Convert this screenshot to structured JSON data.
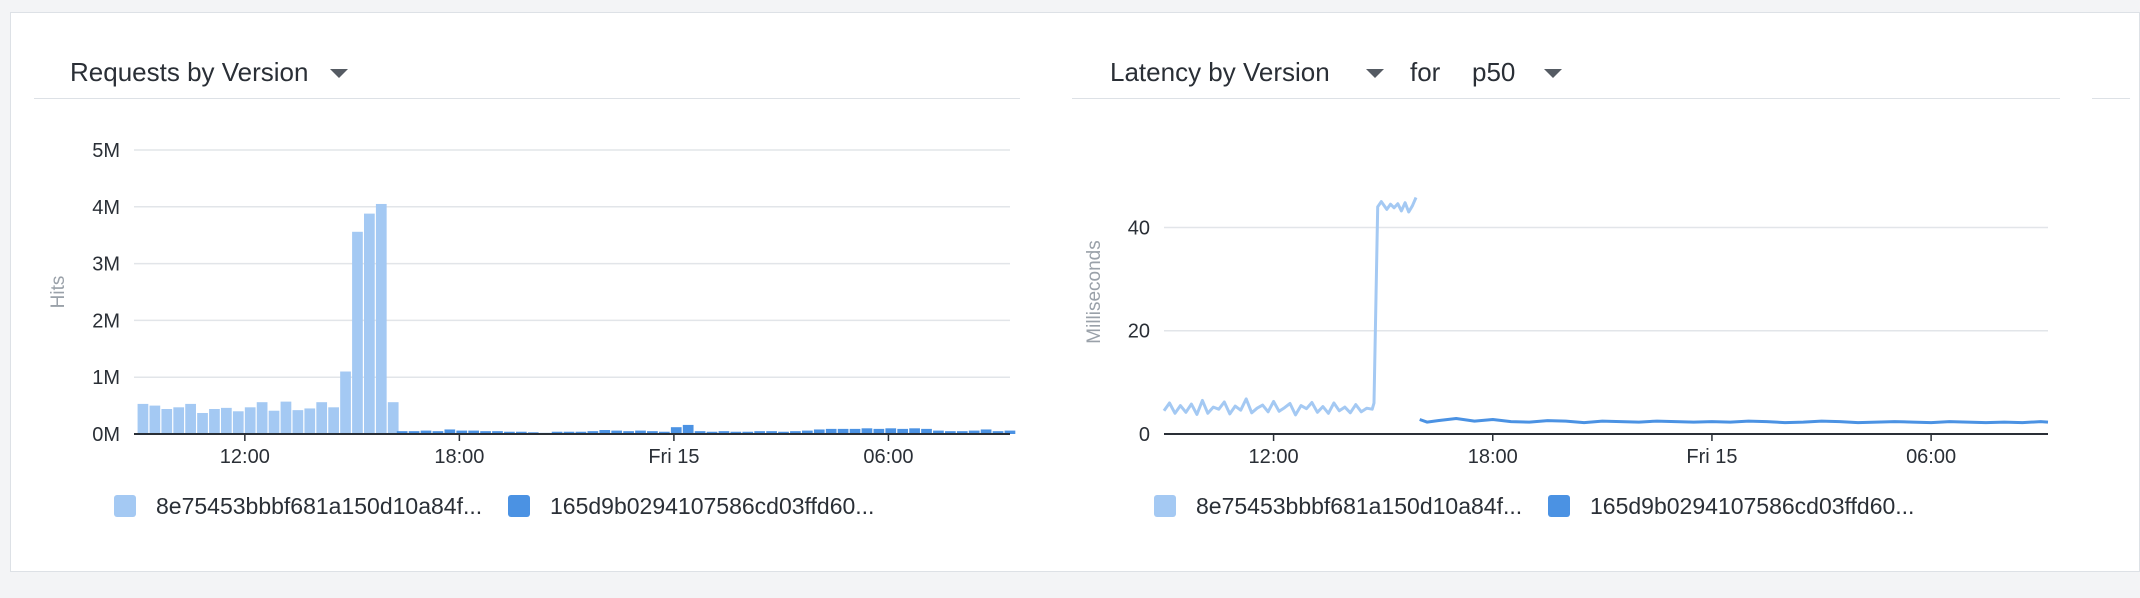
{
  "colors": {
    "light": "#a4c9f3",
    "dark": "#4b92e3",
    "grid": "#e2e5e9",
    "axis": "#2a2f36"
  },
  "requests_widget": {
    "title": "Requests by Version",
    "legend": [
      {
        "label": "8e75453bbbf681a150d10a84f...",
        "color": "#a4c9f3"
      },
      {
        "label": "165d9b0294107586cd03ffd60...",
        "color": "#4b92e3"
      }
    ]
  },
  "latency_widget": {
    "title": "Latency by Version",
    "for_label": "for",
    "percentile": "p50",
    "legend": [
      {
        "label": "8e75453bbbf681a150d10a84f...",
        "color": "#a4c9f3"
      },
      {
        "label": "165d9b0294107586cd03ffd60...",
        "color": "#4b92e3"
      }
    ]
  },
  "chart_data": [
    {
      "type": "bar",
      "title": "Requests by Version",
      "ylabel": "Hits",
      "ylim": [
        0,
        5000000
      ],
      "yticks": [
        0,
        1000000,
        2000000,
        3000000,
        4000000,
        5000000
      ],
      "yticklabels": [
        "0M",
        "1M",
        "2M",
        "3M",
        "4M",
        "5M"
      ],
      "xlim_hours": [
        8.9,
        33.4
      ],
      "xticks": [
        12,
        18,
        24,
        30
      ],
      "xticklabels": [
        "12:00",
        "18:00",
        "Fri 15",
        "06:00"
      ],
      "bar_width_hours": 0.3,
      "grid": true,
      "series": [
        {
          "name": "8e75453bbbf681a150d10a84f...",
          "color": "#a4c9f3",
          "start_hour": 9.0,
          "step_hours": 0.3333,
          "values": [
            530000,
            500000,
            440000,
            470000,
            530000,
            370000,
            440000,
            460000,
            400000,
            470000,
            560000,
            410000,
            570000,
            420000,
            450000,
            560000,
            470000,
            1100000,
            3560000,
            3880000,
            4050000,
            560000
          ]
        },
        {
          "name": "165d9b0294107586cd03ffd60...",
          "color": "#4b92e3",
          "start_hour": 16.25,
          "step_hours": 0.3333,
          "values": [
            50000,
            50000,
            60000,
            50000,
            80000,
            60000,
            60000,
            50000,
            50000,
            40000,
            40000,
            30000,
            20000,
            40000,
            40000,
            40000,
            50000,
            70000,
            60000,
            50000,
            60000,
            50000,
            40000,
            120000,
            160000,
            50000,
            40000,
            50000,
            40000,
            40000,
            50000,
            50000,
            40000,
            50000,
            60000,
            80000,
            90000,
            90000,
            90000,
            100000,
            90000,
            100000,
            90000,
            100000,
            90000,
            60000,
            50000,
            50000,
            60000,
            80000,
            50000,
            60000
          ]
        }
      ]
    },
    {
      "type": "line",
      "title": "Latency by Version",
      "ylabel": "Milliseconds",
      "ylim": [
        0,
        55
      ],
      "yticks": [
        0,
        20,
        40
      ],
      "xlim_hours": [
        9.0,
        33.2
      ],
      "xticks": [
        12,
        18,
        24,
        30
      ],
      "xticklabels": [
        "12:00",
        "18:00",
        "Fri 15",
        "06:00"
      ],
      "grid": true,
      "series": [
        {
          "name": "8e75453bbbf681a150d10a84f...",
          "color": "#a4c9f3",
          "x": [
            9.0,
            9.15,
            9.3,
            9.45,
            9.6,
            9.75,
            9.9,
            10.05,
            10.2,
            10.35,
            10.5,
            10.65,
            10.8,
            10.95,
            11.1,
            11.25,
            11.4,
            11.55,
            11.7,
            11.85,
            12.0,
            12.15,
            12.3,
            12.45,
            12.6,
            12.75,
            12.9,
            13.05,
            13.2,
            13.35,
            13.5,
            13.65,
            13.8,
            13.95,
            14.1,
            14.25,
            14.4,
            14.55,
            14.7,
            14.75,
            14.85,
            14.95,
            15.1,
            15.2,
            15.3,
            15.4,
            15.5,
            15.6,
            15.7,
            15.8,
            15.9
          ],
          "y": [
            4.5,
            6.0,
            4.0,
            5.5,
            4.2,
            5.8,
            3.8,
            6.5,
            4.0,
            5.2,
            4.8,
            6.2,
            3.9,
            5.4,
            4.6,
            6.8,
            4.1,
            5.0,
            5.6,
            4.3,
            6.3,
            4.4,
            5.1,
            5.9,
            3.7,
            5.5,
            4.9,
            6.1,
            4.2,
            5.3,
            4.0,
            6.0,
            4.5,
            5.2,
            4.1,
            5.7,
            4.3,
            5.0,
            4.8,
            6.0,
            44.0,
            45.0,
            43.5,
            44.5,
            43.8,
            44.6,
            43.2,
            44.8,
            43.0,
            44.2,
            45.8
          ]
        },
        {
          "name": "165d9b0294107586cd03ffd60...",
          "color": "#4b92e3",
          "x": [
            16.0,
            16.2,
            16.5,
            17.0,
            17.5,
            18.0,
            18.5,
            19.0,
            19.5,
            20.0,
            20.5,
            21.0,
            21.5,
            22.0,
            22.5,
            23.0,
            23.5,
            24.0,
            24.5,
            25.0,
            25.5,
            26.0,
            26.5,
            27.0,
            27.5,
            28.0,
            28.5,
            29.0,
            29.5,
            30.0,
            30.5,
            31.0,
            31.5,
            32.0,
            32.5,
            33.0,
            33.2
          ],
          "y": [
            2.8,
            2.3,
            2.6,
            3.0,
            2.5,
            2.8,
            2.4,
            2.3,
            2.6,
            2.5,
            2.2,
            2.5,
            2.4,
            2.3,
            2.5,
            2.4,
            2.3,
            2.4,
            2.3,
            2.5,
            2.4,
            2.2,
            2.3,
            2.5,
            2.4,
            2.2,
            2.3,
            2.4,
            2.3,
            2.2,
            2.4,
            2.3,
            2.2,
            2.3,
            2.2,
            2.4,
            2.3
          ]
        }
      ]
    }
  ]
}
